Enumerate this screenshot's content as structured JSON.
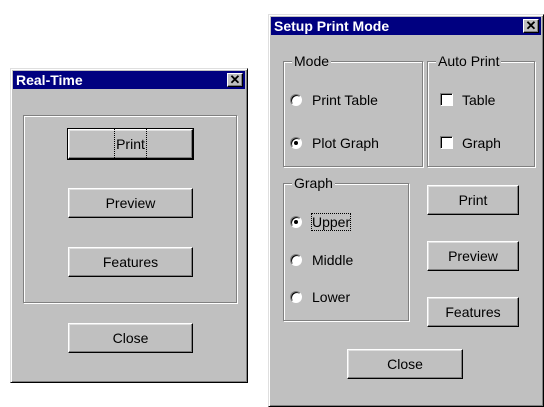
{
  "realtime": {
    "title": "Real-Time",
    "print_label": "Print",
    "preview_label": "Preview",
    "features_label": "Features",
    "close_label": "Close"
  },
  "setup": {
    "title": "Setup Print Mode",
    "mode": {
      "legend": "Mode",
      "options": [
        {
          "label": "Print Table",
          "selected": false
        },
        {
          "label": "Plot Graph",
          "selected": true
        }
      ]
    },
    "auto_print": {
      "legend": "Auto Print",
      "options": [
        {
          "label": "Table",
          "checked": false
        },
        {
          "label": "Graph",
          "checked": false
        }
      ]
    },
    "graph": {
      "legend": "Graph",
      "options": [
        {
          "label": "Upper",
          "selected": true
        },
        {
          "label": "Middle",
          "selected": false
        },
        {
          "label": "Lower",
          "selected": false
        }
      ]
    },
    "print_label": "Print",
    "preview_label": "Preview",
    "features_label": "Features",
    "close_label": "Close"
  }
}
